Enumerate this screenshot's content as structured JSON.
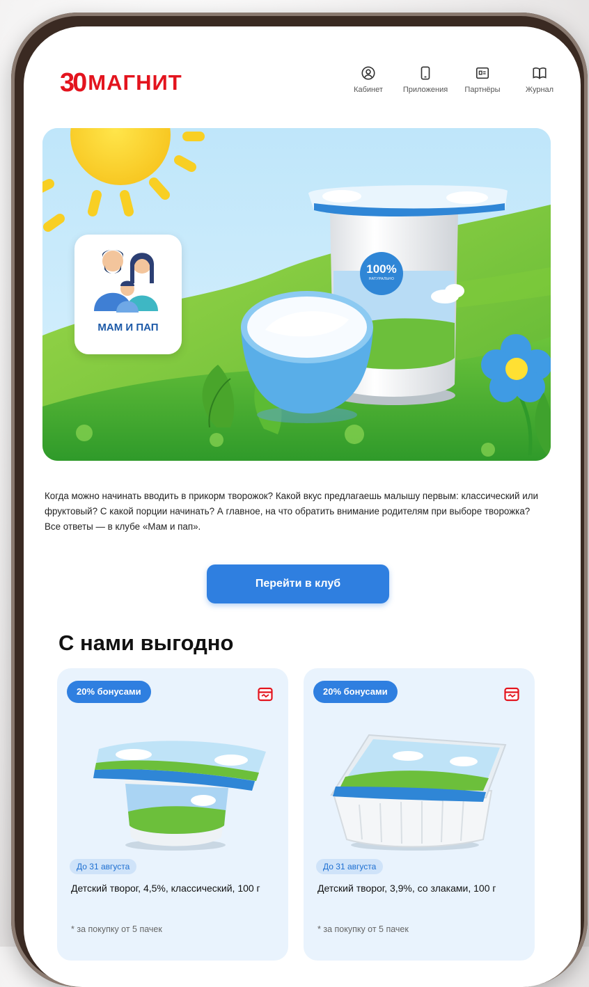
{
  "header": {
    "logo_badge": "30",
    "logo_text": "МАГНИТ",
    "nav": [
      {
        "label": "Кабинет",
        "icon": "user-circle-icon"
      },
      {
        "label": "Приложения",
        "icon": "phone-icon"
      },
      {
        "label": "Партнёры",
        "icon": "card-icon"
      },
      {
        "label": "Журнал",
        "icon": "book-icon"
      }
    ]
  },
  "hero": {
    "club_name": "МАМ И ПАП",
    "jar_badge_value": "100%",
    "jar_badge_sub": "НАТУРАЛЬНО"
  },
  "intro_text": "Когда можно начинать вводить в прикорм творожок? Какой вкус предлагаешь малышу первым: классический или фруктовый? С какой порции начинать? А главное, на что обратить внимание родителям при выборе творожка? Все ответы — в клубе «Мам и пап».",
  "cta_label": "Перейти в клуб",
  "section_title": "С нами выгодно",
  "products": [
    {
      "promo": "20% бонусами",
      "date": "До 31 августа",
      "name": "Детский творог, 4,5%, классический, 100 г",
      "note": "* за покупку от 5 пачек"
    },
    {
      "promo": "20% бонусами",
      "date": "До 31 августа",
      "name": "Детский творог, 3,9%, со злаками, 100 г",
      "note": "* за покупку от 5 пачек"
    }
  ],
  "colors": {
    "brand_red": "#e3141e",
    "accent_blue": "#2f7fe0",
    "card_bg": "#e9f3fd"
  }
}
